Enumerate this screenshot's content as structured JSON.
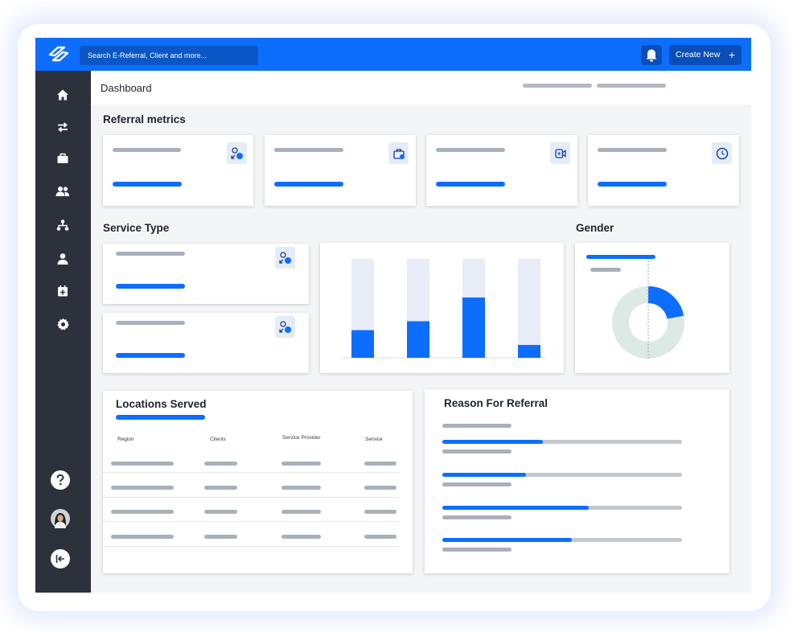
{
  "header": {
    "search_placeholder": "Search E-Referral, Client and more...",
    "create_label": "Create New",
    "create_plus": "+"
  },
  "page": {
    "title": "Dashboard"
  },
  "sections": {
    "referral_metrics": "Referral metrics",
    "service_type": "Service Type",
    "gender": "Gender",
    "locations_served": "Locations Served",
    "reason_for_referral": "Reason For Referral"
  },
  "metric_cards": [
    {
      "icon": "person-arrow-icon"
    },
    {
      "icon": "briefcase-icon"
    },
    {
      "icon": "video-call-icon"
    },
    {
      "icon": "clock-icon"
    }
  ],
  "service_chart": {
    "type": "bar",
    "values": [
      0.28,
      0.37,
      0.61,
      0.13
    ]
  },
  "gender_chart": {
    "type": "donut",
    "segment_fraction": 0.22,
    "accent": "#0d6efd",
    "base": "#dde9e5"
  },
  "locations_table": {
    "columns": [
      "Region",
      "Clients",
      "Service Provider",
      "Service"
    ],
    "rows": 4
  },
  "reason_bars": [
    0.42,
    0.35,
    0.61,
    0.54
  ],
  "sidebar_icons": [
    "home-icon",
    "transfer-icon",
    "briefcase-icon",
    "users-icon",
    "org-chart-icon",
    "user-icon",
    "calendar-add-icon",
    "gear-icon"
  ],
  "colors": {
    "primary": "#0d6efd",
    "sidebar": "#2d313c",
    "background": "#f4f5f7"
  }
}
